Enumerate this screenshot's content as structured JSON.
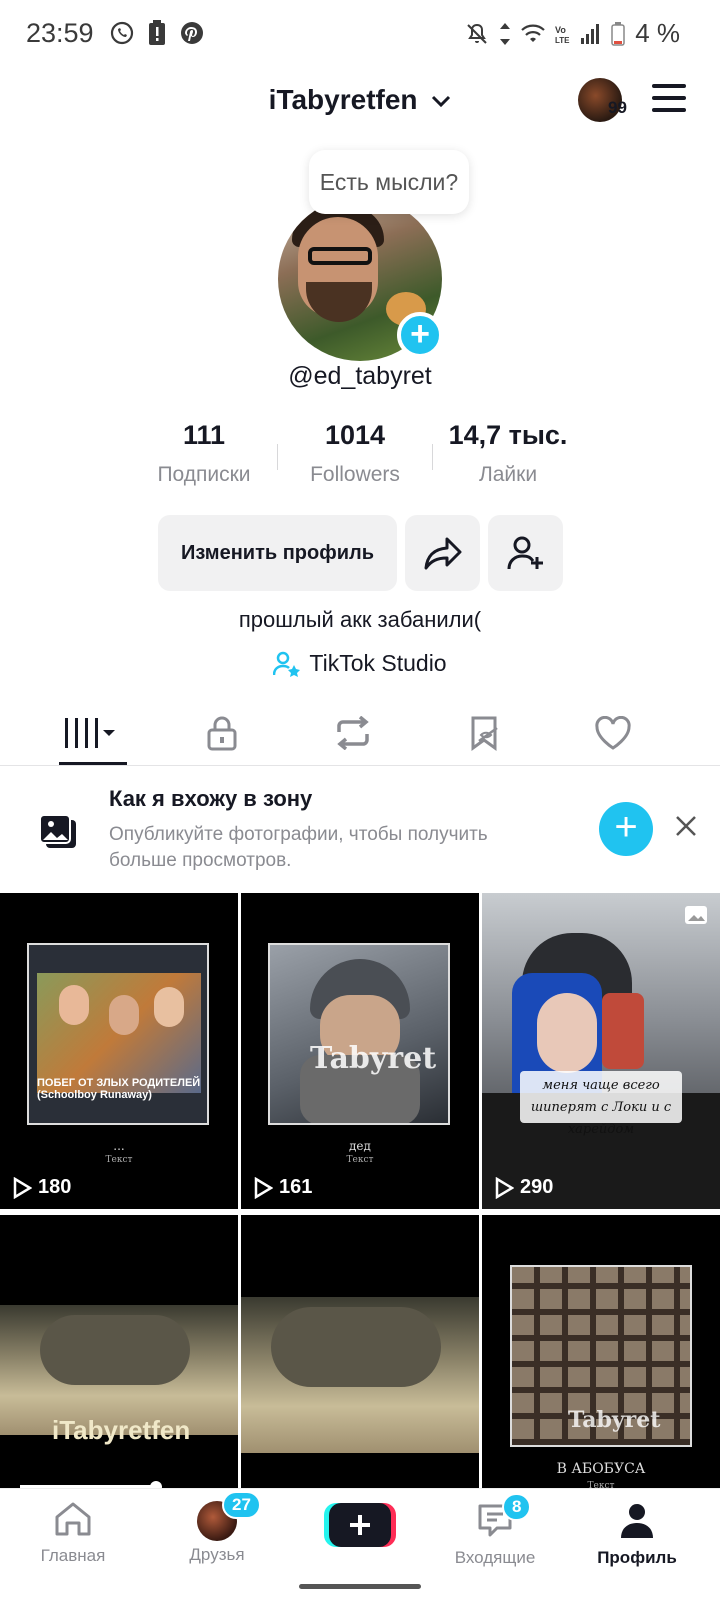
{
  "status_bar": {
    "time": "23:59",
    "battery_text": "4 %",
    "icons": [
      "whatsapp-icon",
      "battery-alert-icon",
      "pinterest-icon",
      "mute-icon",
      "data-arrows-icon",
      "wifi-icon",
      "volte-icon",
      "signal-icon",
      "battery-icon"
    ]
  },
  "header": {
    "username": "iTabyretfen",
    "avatar_badge": "99"
  },
  "profile": {
    "thought_prompt": "Есть мысли?",
    "handle": "@ed_tabyret",
    "stats": [
      {
        "value": "111",
        "label": "Подписки"
      },
      {
        "value": "1014",
        "label": "Followers"
      },
      {
        "value": "14,7 тыс.",
        "label": "Лайки"
      }
    ],
    "edit_button": "Изменить профиль",
    "bio": "прошлый акк забанили(",
    "studio_link": "TikTok Studio"
  },
  "tabs": [
    "videos",
    "private",
    "reposts",
    "favorites-hidden",
    "liked"
  ],
  "banner": {
    "title": "Как я вхожу в зону",
    "subtitle": "Опубликуйте фотографии, чтобы получить больше просмотров."
  },
  "videos": [
    {
      "plays": "180",
      "overlay": "ПОБЕГ ОТ ЗЛЫХ РОДИТЕЛЕЙ (Schoolboy Runaway)",
      "caption": "...",
      "caption_sub": "Текст"
    },
    {
      "plays": "161",
      "overlay": "Tabyret",
      "caption": "дед",
      "caption_sub": "Текст"
    },
    {
      "plays": "290",
      "overlay": "меня чаще всего шиперят с Локи и с харейдом",
      "caption": "",
      "caption_sub": ""
    },
    {
      "plays": "",
      "overlay": "iTabyretfen",
      "caption": "",
      "caption_sub": ""
    },
    {
      "plays": "",
      "overlay": "",
      "caption": "",
      "caption_sub": ""
    },
    {
      "plays": "",
      "overlay": "Tabyret",
      "caption": "В АБОБУСА",
      "caption_sub": "Текст"
    }
  ],
  "bottom_nav": {
    "home": "Главная",
    "friends": "Друзья",
    "friends_badge": "27",
    "inbox": "Входящие",
    "inbox_badge": "8",
    "profile": "Профиль"
  }
}
